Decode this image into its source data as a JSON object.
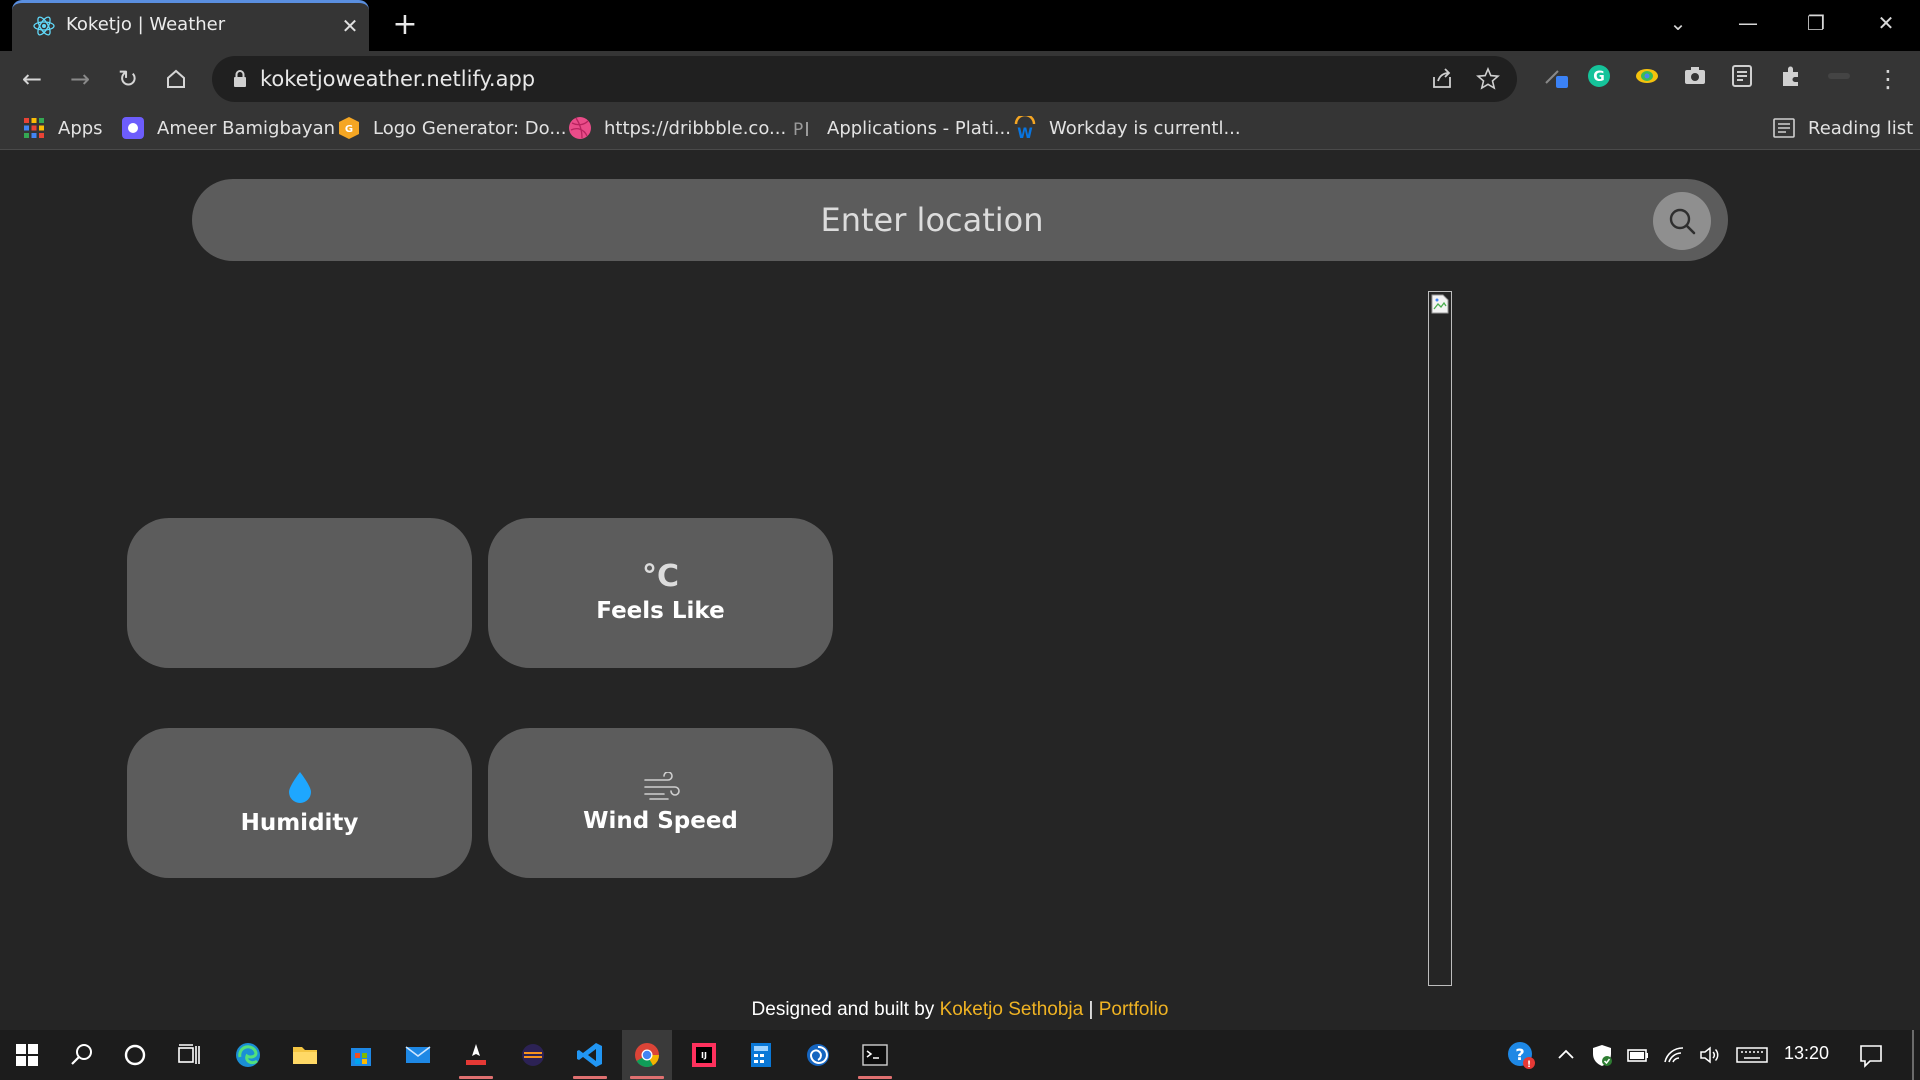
{
  "browser": {
    "tab_title": "Koketjo | Weather",
    "url": "koketjoweather.netlify.app",
    "reading_list": "Reading list",
    "bookmarks": [
      {
        "label": "Apps",
        "icon": "apps-grid-icon"
      },
      {
        "label": "Ameer Bamigbayan",
        "icon": "profile-icon"
      },
      {
        "label": "Logo Generator: Do...",
        "icon": "logo-generator-icon"
      },
      {
        "label": "https://dribbble.co...",
        "icon": "dribbble-icon"
      },
      {
        "label": "Applications - Plati...",
        "icon": "platinum-icon"
      },
      {
        "label": "Workday is currentl...",
        "icon": "workday-icon"
      }
    ]
  },
  "search": {
    "placeholder": "Enter location"
  },
  "cards": {
    "feels_like": {
      "unit": "°C",
      "label": "Feels Like"
    },
    "humidity": {
      "label": "Humidity",
      "icon": "water-drop-icon"
    },
    "wind_speed": {
      "label": "Wind Speed",
      "icon": "wind-icon"
    }
  },
  "footer": {
    "prefix": "Designed and built by ",
    "author": "Koketjo Sethobja",
    "separator": " | ",
    "portfolio": "Portfolio"
  },
  "taskbar": {
    "clock": "13:20"
  },
  "colors": {
    "page_bg": "#252525",
    "card_bg": "#5c5c5c",
    "accent_link": "#f0b323",
    "humidity_drop": "#1ea7ff"
  }
}
